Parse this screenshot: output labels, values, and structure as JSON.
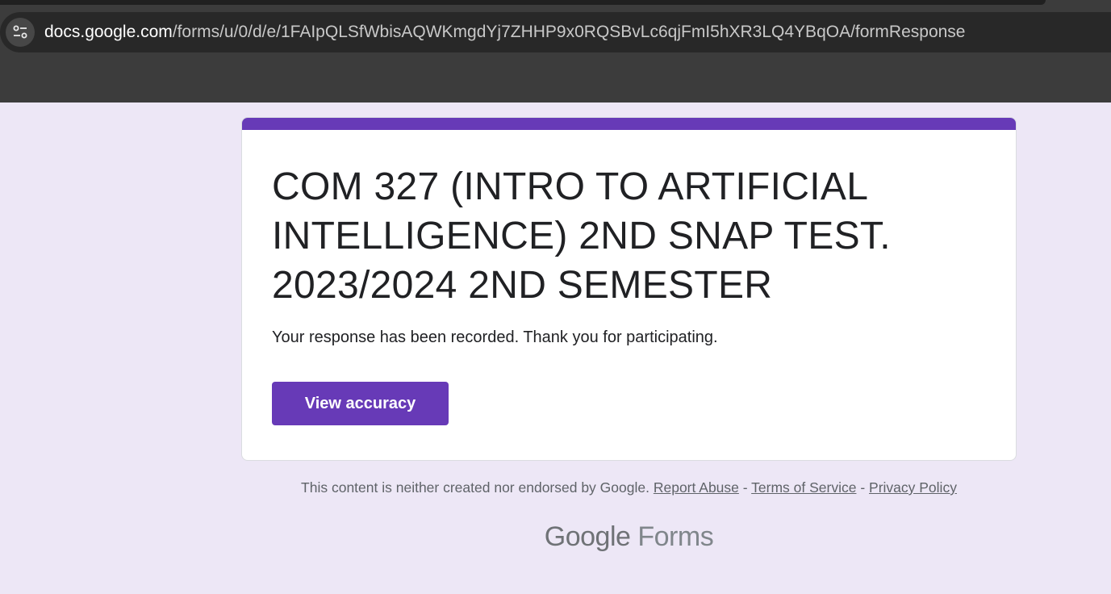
{
  "browser": {
    "url_host": "docs.google.com",
    "url_path": "/forms/u/0/d/e/1FAIpQLSfWbisAQWKmgdYj7ZHHP9x0RQSBvLc6qjFmI5hXR3LQ4YBqOA/formResponse",
    "site_info_icon": "tune-icon"
  },
  "form": {
    "accent_color": "#673ab7",
    "title": "COM 327 (INTRO TO ARTIFICIAL INTELLIGENCE) 2ND SNAP TEST. 2023/2024 2ND SEMESTER",
    "confirmation_message": "Your response has been recorded. Thank you for participating.",
    "view_accuracy_label": "View accuracy"
  },
  "footer": {
    "disclaimer": "This content is neither created nor endorsed by Google.",
    "report_abuse": "Report Abuse",
    "separator": "-",
    "terms": "Terms of Service",
    "privacy": "Privacy Policy",
    "logo_google": "Google",
    "logo_forms": "Forms"
  }
}
